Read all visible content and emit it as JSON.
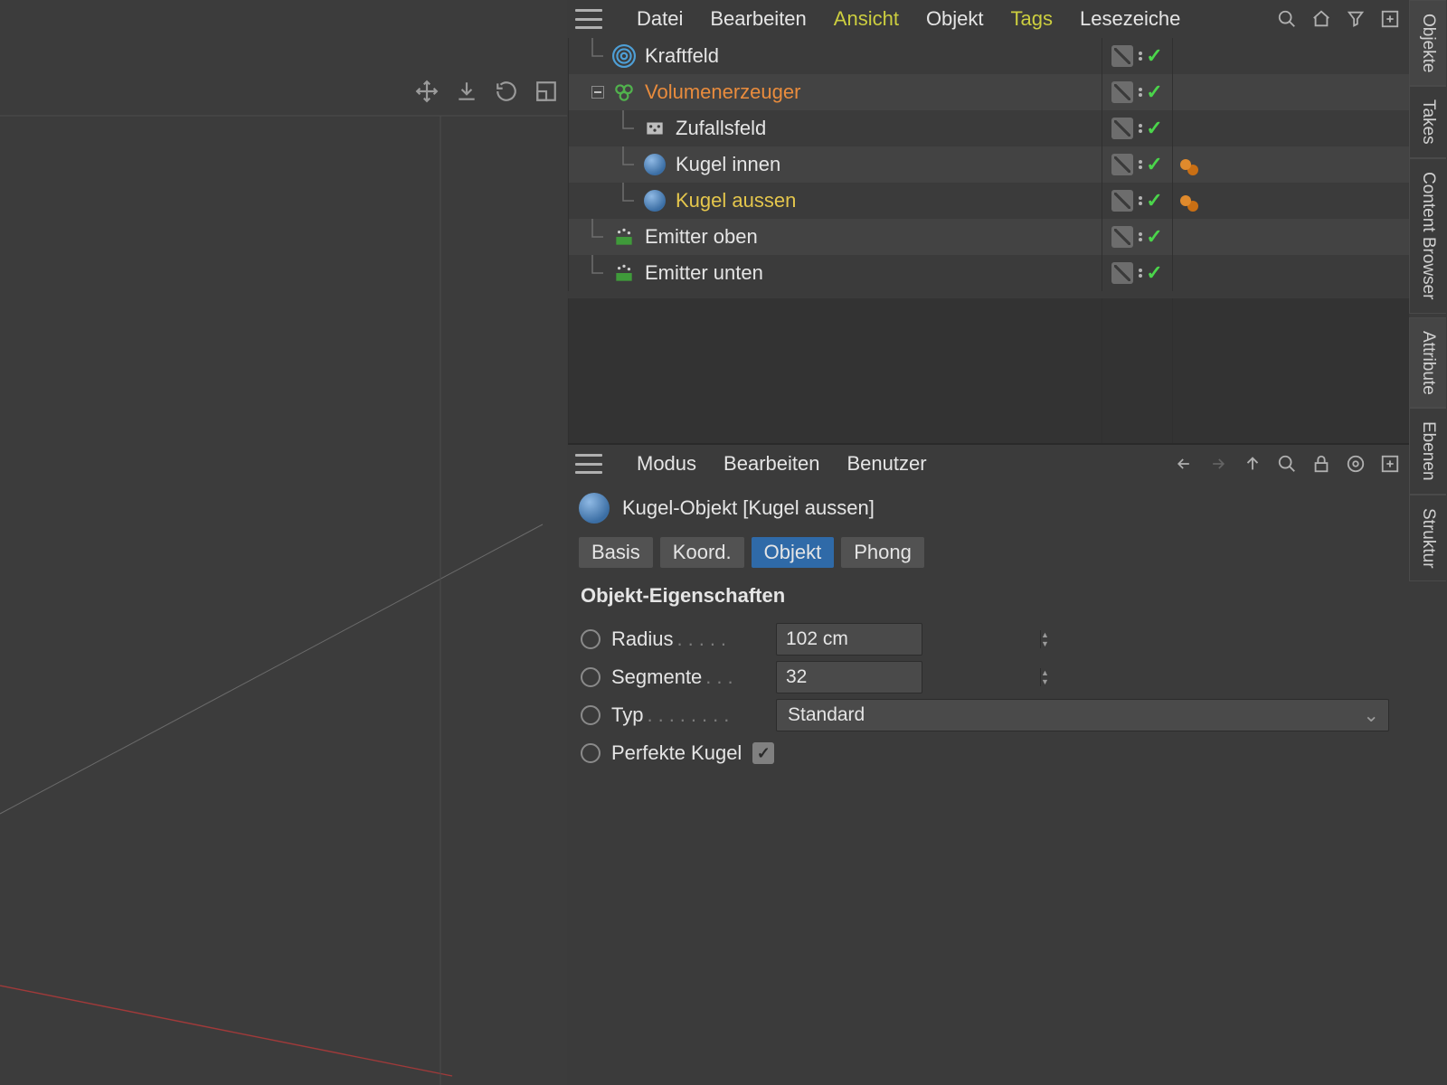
{
  "object_manager": {
    "menu": {
      "file": "Datei",
      "edit": "Bearbeiten",
      "view": "Ansicht",
      "object": "Objekt",
      "tags": "Tags",
      "bookmarks": "Lesezeiche"
    },
    "tree": [
      {
        "label": "Kraftfeld",
        "indent": 0,
        "icon": "forcefield",
        "style": "plain",
        "tags": []
      },
      {
        "label": "Volumenerzeuger",
        "indent": 0,
        "icon": "volume",
        "style": "orange",
        "tags": [],
        "expand": "minus"
      },
      {
        "label": "Zufallsfeld",
        "indent": 1,
        "icon": "random",
        "style": "plain",
        "tags": []
      },
      {
        "label": "Kugel innen",
        "indent": 1,
        "icon": "sphere",
        "style": "plain",
        "tags": [
          "phong"
        ]
      },
      {
        "label": "Kugel aussen",
        "indent": 1,
        "icon": "sphere",
        "style": "yellow",
        "tags": [
          "phong"
        ]
      },
      {
        "label": "Emitter oben",
        "indent": 0,
        "icon": "emitter",
        "style": "plain",
        "tags": []
      },
      {
        "label": "Emitter unten",
        "indent": 0,
        "icon": "emitter",
        "style": "plain",
        "tags": []
      }
    ]
  },
  "attribute_manager": {
    "menu": {
      "mode": "Modus",
      "edit": "Bearbeiten",
      "user": "Benutzer"
    },
    "title": "Kugel-Objekt [Kugel aussen]",
    "tabs": {
      "basis": "Basis",
      "koord": "Koord.",
      "objekt": "Objekt",
      "phong": "Phong"
    },
    "section": "Objekt-Eigenschaften",
    "props": {
      "radius_label": "Radius",
      "radius_value": "102 cm",
      "segments_label": "Segmente",
      "segments_value": "32",
      "type_label": "Typ",
      "type_value": "Standard",
      "perfect_label": "Perfekte Kugel",
      "perfect_checked": true
    }
  },
  "side_tabs": {
    "objects": "Objekte",
    "takes": "Takes",
    "content": "Content Browser",
    "attribute": "Attribute",
    "layers": "Ebenen",
    "structure": "Struktur"
  }
}
